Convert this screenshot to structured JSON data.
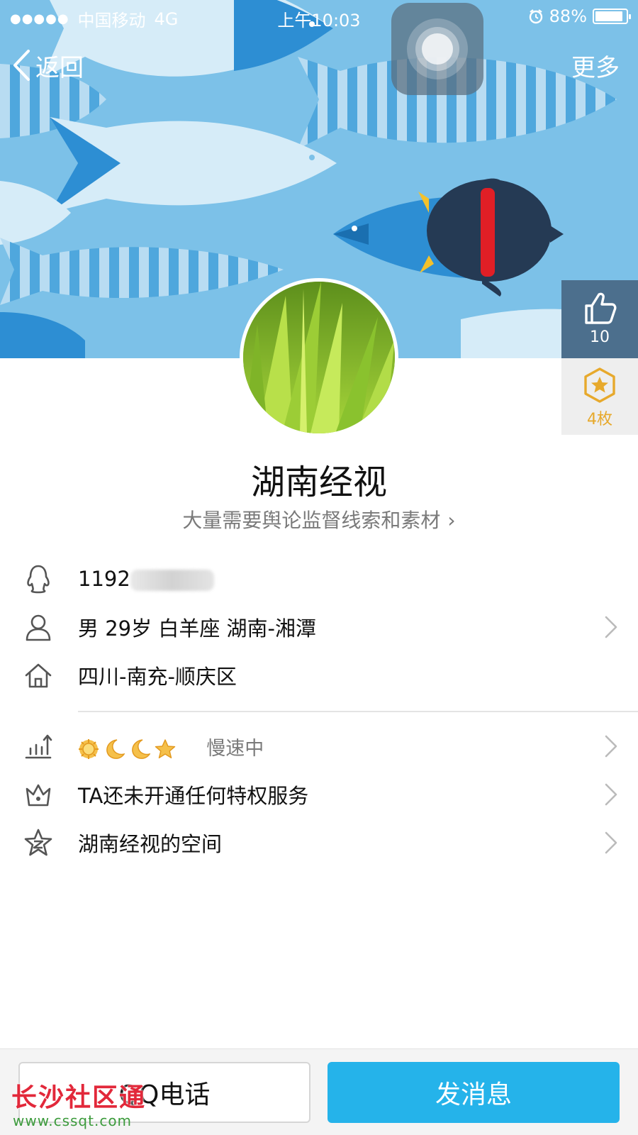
{
  "status_bar": {
    "signal": "●●●●●",
    "carrier": "中国移动",
    "network": "4G",
    "time": "上午10:03",
    "battery": "88%"
  },
  "nav": {
    "back_label": "返回",
    "more_label": "更多"
  },
  "likes": {
    "count": "10"
  },
  "badges": {
    "count": "4枚"
  },
  "profile": {
    "nickname": "湖南经视",
    "signature": "大量需要舆论监督线索和素材",
    "signature_chevron": "›"
  },
  "info": {
    "qq_number_visible": "1192",
    "basic": "男 29岁 白羊座 湖南-湘潭",
    "hometown": "四川-南充-顺庆区",
    "level_status": "慢速中",
    "privilege": "TA还未开通任何特权服务",
    "space": "湖南经视的空间"
  },
  "actions": {
    "call_label": "QQ电话",
    "message_label": "发消息"
  },
  "watermark": {
    "title": "长沙社区通",
    "url": "www.cssqt.com"
  },
  "colors": {
    "banner": "#7cc1e8",
    "accent": "#25b3ea",
    "gold": "#e7a92c"
  }
}
